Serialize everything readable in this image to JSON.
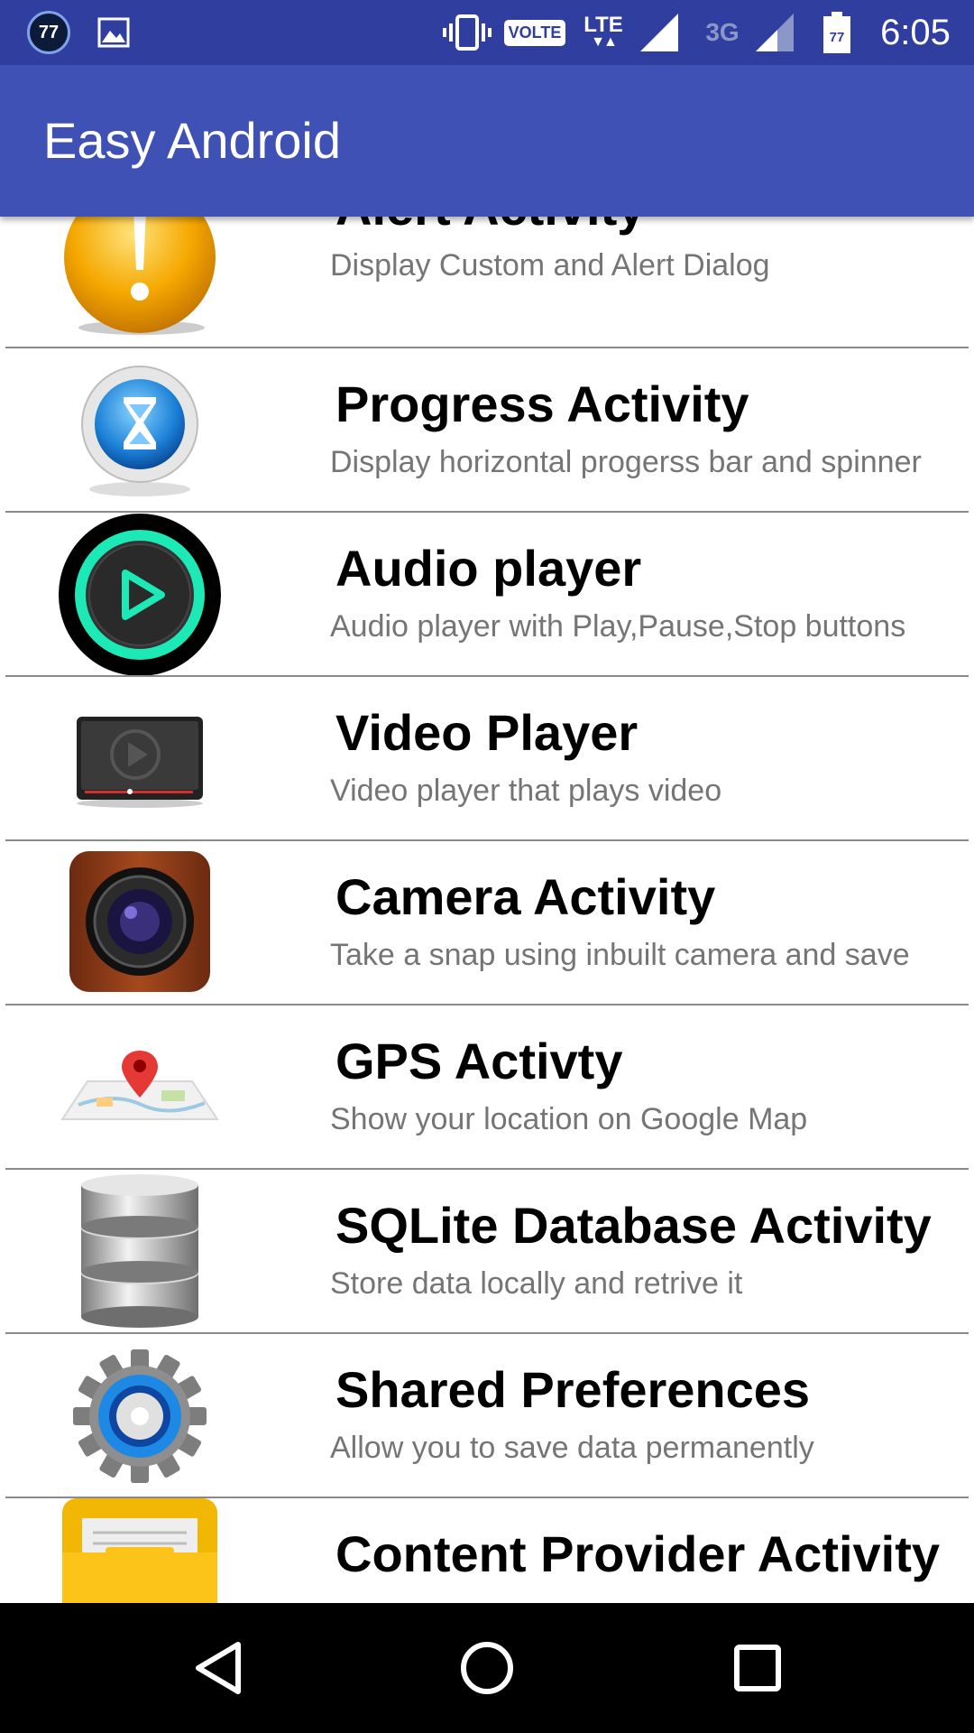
{
  "status_bar": {
    "notification_badge": "77",
    "network_type": "VOLTE",
    "lte_label": "LTE",
    "secondary_network": "3G",
    "battery_level": "77",
    "time": "6:05"
  },
  "app_bar": {
    "title": "Easy Android",
    "color": "#3f51b5"
  },
  "list": {
    "items": [
      {
        "icon": "alert-icon",
        "title": "Alert Activity",
        "subtitle": "Display Custom and Alert Dialog"
      },
      {
        "icon": "hourglass-icon",
        "title": "Progress Activity",
        "subtitle": "Display horizontal progerss bar and spinner"
      },
      {
        "icon": "audio-play-icon",
        "title": "Audio player",
        "subtitle": "Audio player with Play,Pause,Stop buttons"
      },
      {
        "icon": "video-player-icon",
        "title": "Video Player",
        "subtitle": "Video player that plays video"
      },
      {
        "icon": "camera-icon",
        "title": "Camera Activity",
        "subtitle": "Take a snap using inbuilt camera and save"
      },
      {
        "icon": "map-pin-icon",
        "title": "GPS Activty",
        "subtitle": "Show your location on Google Map"
      },
      {
        "icon": "database-icon",
        "title": "SQLite Database Activity",
        "subtitle": "Store data locally and retrive it"
      },
      {
        "icon": "gear-icon",
        "title": "Shared Preferences",
        "subtitle": "Allow you to save data permanently"
      },
      {
        "icon": "folder-icon",
        "title": "Content Provider Activity",
        "subtitle": ""
      }
    ]
  },
  "nav_bar": {
    "back_icon": "back-triangle-icon",
    "home_icon": "home-circle-icon",
    "recents_icon": "recents-square-icon"
  }
}
